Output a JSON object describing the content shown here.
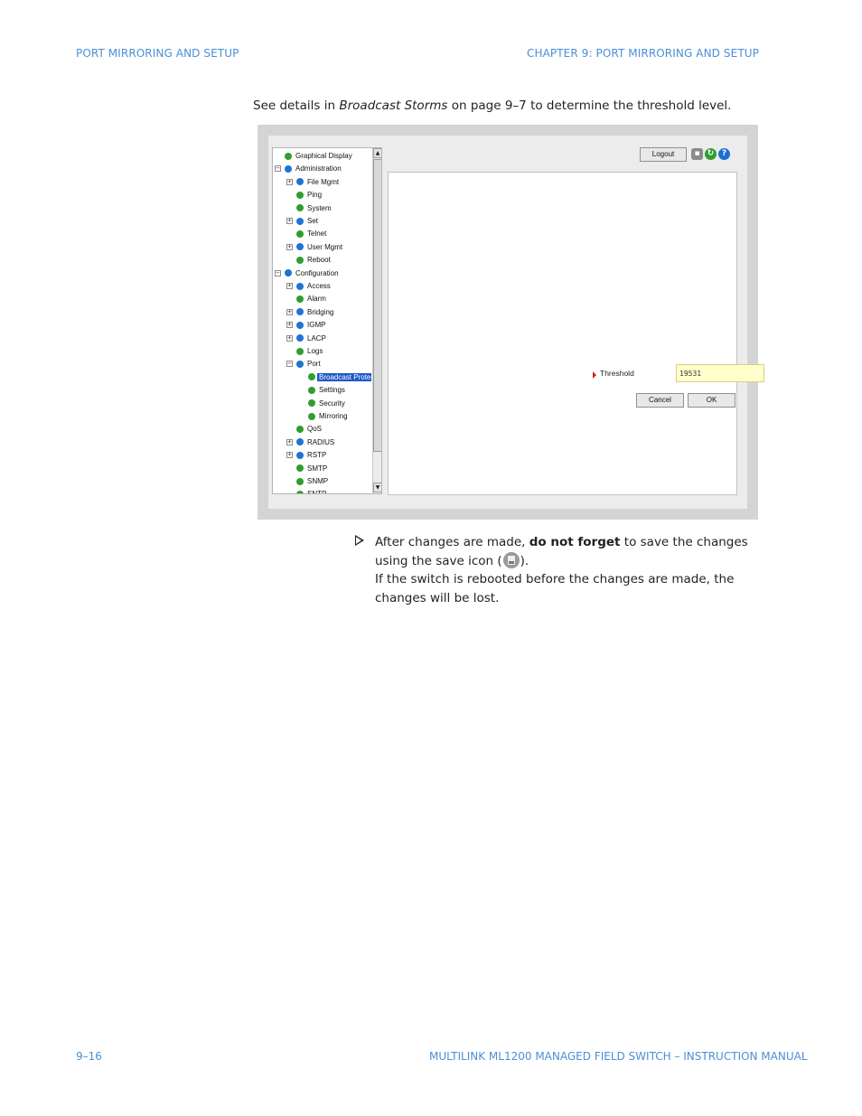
{
  "header": {
    "left": "PORT MIRRORING AND SETUP",
    "right": "CHAPTER 9: PORT MIRRORING AND SETUP"
  },
  "intro": {
    "before": "See details in ",
    "emphasis": "Broadcast Storms",
    "after": " on page 9–7 to determine the threshold level."
  },
  "screenshot": {
    "tree": [
      {
        "label": "Graphical Display",
        "depth": 0,
        "expander": "",
        "icon": "green"
      },
      {
        "label": "Administration",
        "depth": 0,
        "expander": "−",
        "icon": "blue"
      },
      {
        "label": "File Mgmt",
        "depth": 1,
        "expander": "+",
        "icon": "blue"
      },
      {
        "label": "Ping",
        "depth": 1,
        "expander": "",
        "icon": "green"
      },
      {
        "label": "System",
        "depth": 1,
        "expander": "",
        "icon": "green"
      },
      {
        "label": "Set",
        "depth": 1,
        "expander": "+",
        "icon": "blue"
      },
      {
        "label": "Telnet",
        "depth": 1,
        "expander": "",
        "icon": "green"
      },
      {
        "label": "User Mgmt",
        "depth": 1,
        "expander": "+",
        "icon": "blue"
      },
      {
        "label": "Reboot",
        "depth": 1,
        "expander": "",
        "icon": "green"
      },
      {
        "label": "Configuration",
        "depth": 0,
        "expander": "−",
        "icon": "blue"
      },
      {
        "label": "Access",
        "depth": 1,
        "expander": "+",
        "icon": "blue"
      },
      {
        "label": "Alarm",
        "depth": 1,
        "expander": "",
        "icon": "green"
      },
      {
        "label": "Bridging",
        "depth": 1,
        "expander": "+",
        "icon": "blue"
      },
      {
        "label": "IGMP",
        "depth": 1,
        "expander": "+",
        "icon": "blue"
      },
      {
        "label": "LACP",
        "depth": 1,
        "expander": "+",
        "icon": "blue"
      },
      {
        "label": "Logs",
        "depth": 1,
        "expander": "",
        "icon": "green"
      },
      {
        "label": "Port",
        "depth": 1,
        "expander": "−",
        "icon": "blue"
      },
      {
        "label": "Broadcast Protect",
        "depth": 2,
        "expander": "",
        "icon": "green",
        "selected": true
      },
      {
        "label": "Settings",
        "depth": 2,
        "expander": "",
        "icon": "green"
      },
      {
        "label": "Security",
        "depth": 2,
        "expander": "",
        "icon": "green"
      },
      {
        "label": "Mirroring",
        "depth": 2,
        "expander": "",
        "icon": "green"
      },
      {
        "label": "QoS",
        "depth": 1,
        "expander": "",
        "icon": "green"
      },
      {
        "label": "RADIUS",
        "depth": 1,
        "expander": "+",
        "icon": "blue"
      },
      {
        "label": "RSTP",
        "depth": 1,
        "expander": "+",
        "icon": "blue"
      },
      {
        "label": "SMTP",
        "depth": 1,
        "expander": "",
        "icon": "green"
      },
      {
        "label": "SNMP",
        "depth": 1,
        "expander": "",
        "icon": "green"
      },
      {
        "label": "SNTP",
        "depth": 1,
        "expander": "",
        "icon": "green"
      }
    ],
    "logout_label": "Logout",
    "threshold_label": "Threshold",
    "threshold_value": "19531",
    "cancel_label": "Cancel",
    "ok_label": "OK"
  },
  "note": {
    "part1": "After changes are made, ",
    "bold": "do not forget",
    "part2": " to save the changes using the save icon (",
    "part3": ").",
    "line2": "If the switch is rebooted before the changes are made, the changes will be lost."
  },
  "footer": {
    "left": "9–16",
    "right": "MULTILINK ML1200 MANAGED FIELD SWITCH – INSTRUCTION MANUAL"
  },
  "colors": {
    "accent": "#4a8fd6",
    "selection": "#1d57c6",
    "input_bg": "#ffffcc"
  }
}
